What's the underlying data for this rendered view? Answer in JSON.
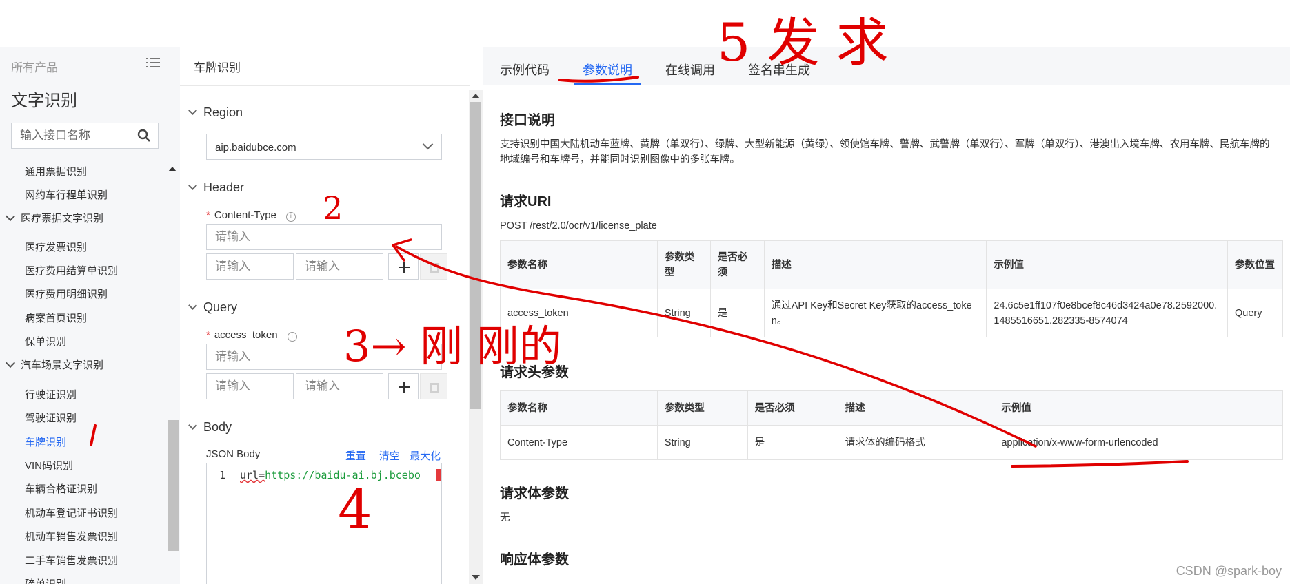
{
  "sidebar": {
    "all_products": "所有产品",
    "title": "文字识别",
    "search_placeholder": "输入接口名称",
    "items": [
      {
        "label": "通用票据识别",
        "type": "item"
      },
      {
        "label": "网约车行程单识别",
        "type": "item"
      },
      {
        "label": "医疗票据文字识别",
        "type": "group"
      },
      {
        "label": "医疗发票识别",
        "type": "item"
      },
      {
        "label": "医疗费用结算单识别",
        "type": "item"
      },
      {
        "label": "医疗费用明细识别",
        "type": "item"
      },
      {
        "label": "病案首页识别",
        "type": "item"
      },
      {
        "label": "保单识别",
        "type": "item"
      },
      {
        "label": "汽车场景文字识别",
        "type": "group"
      },
      {
        "label": "行驶证识别",
        "type": "item"
      },
      {
        "label": "驾驶证识别",
        "type": "item"
      },
      {
        "label": "车牌识别",
        "type": "item",
        "active": true
      },
      {
        "label": "VIN码识别",
        "type": "item"
      },
      {
        "label": "车辆合格证识别",
        "type": "item"
      },
      {
        "label": "机动车登记证书识别",
        "type": "item"
      },
      {
        "label": "机动车销售发票识别",
        "type": "item"
      },
      {
        "label": "二手车销售发票识别",
        "type": "item"
      },
      {
        "label": "磅单识别",
        "type": "item"
      }
    ]
  },
  "middle": {
    "title": "车牌识别",
    "region": {
      "label": "Region",
      "value": "aip.baidubce.com"
    },
    "header": {
      "label": "Header",
      "field_label": "Content-Type",
      "placeholder": "请输入"
    },
    "query": {
      "label": "Query",
      "field_label": "access_token",
      "placeholder": "请输入"
    },
    "body": {
      "label": "Body",
      "json_label": "JSON Body",
      "reset": "重置",
      "clear": "清空",
      "maximize": "最大化",
      "line_number": "1",
      "code_prefix": "url=",
      "code_value": "https://baidu-ai.bj.bcebo"
    }
  },
  "right": {
    "tabs": [
      "示例代码",
      "参数说明",
      "在线调用",
      "签名串生成"
    ],
    "active_tab": "参数说明",
    "interface_title": "接口说明",
    "interface_desc": "支持识别中国大陆机动车蓝牌、黄牌（单双行）、绿牌、大型新能源（黄绿）、领使馆车牌、警牌、武警牌（单双行）、军牌（单双行）、港澳出入境车牌、农用车牌、民航车牌的地域编号和车牌号，并能同时识别图像中的多张车牌。",
    "uri_title": "请求URI",
    "uri": "POST /rest/2.0/ocr/v1/license_plate",
    "uri_table": {
      "headers": [
        "参数名称",
        "参数类型",
        "是否必须",
        "描述",
        "示例值",
        "参数位置"
      ],
      "rows": [
        [
          "access_token",
          "String",
          "是",
          "通过API Key和Secret Key获取的access_token。",
          "24.6c5e1ff107f0e8bcef8c46d3424a0e78.2592000.1485516651.282335-8574074",
          "Query"
        ]
      ]
    },
    "header_title": "请求头参数",
    "header_table": {
      "headers": [
        "参数名称",
        "参数类型",
        "是否必须",
        "描述",
        "示例值"
      ],
      "rows": [
        [
          "Content-Type",
          "String",
          "是",
          "请求体的编码格式",
          "application/x-www-form-urlencoded"
        ]
      ]
    },
    "body_title": "请求体参数",
    "body_value": "无",
    "response_title": "响应体参数"
  },
  "watermark": "CSDN @spark-boy",
  "annotations": {
    "n1": "1",
    "n2": "2",
    "n3": "3→ 刚 刚的",
    "n4": "4",
    "n5": "5 发 求",
    "color": "#e00000"
  },
  "colors": {
    "accent": "#2468f2",
    "required": "#e4393c"
  }
}
